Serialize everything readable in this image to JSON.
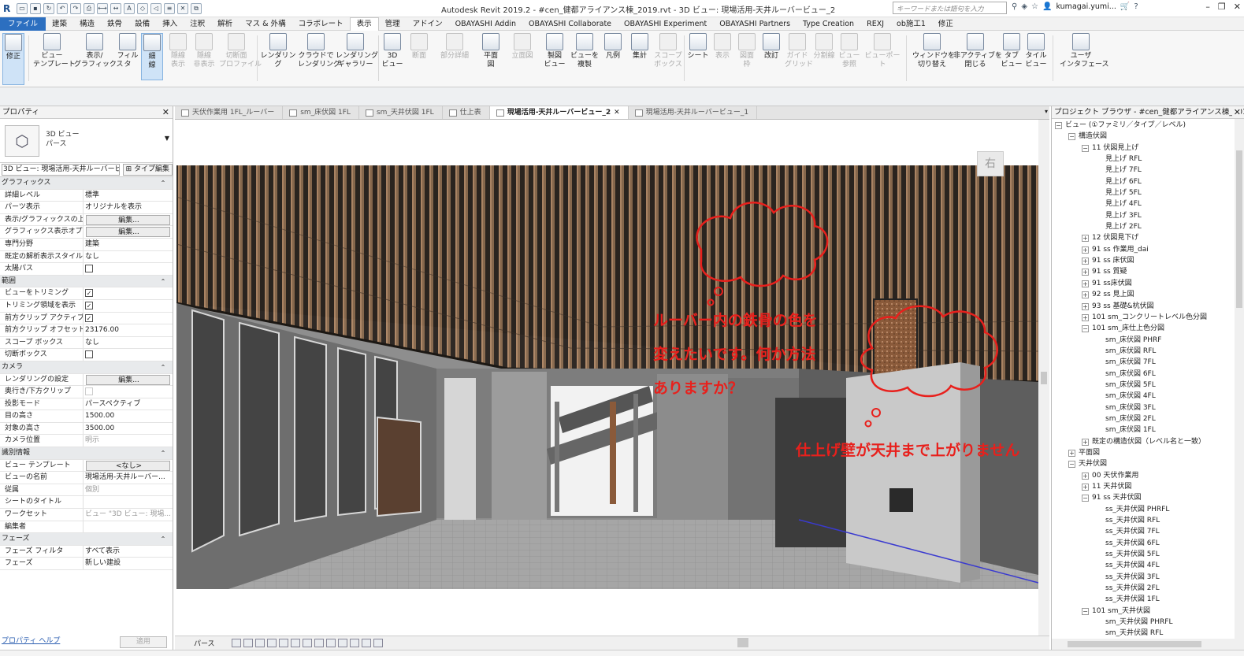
{
  "window": {
    "title": "Autodesk Revit 2019.2 - #cen_健都アライアンス棟_2019.rvt - 3D ビュー: 現場活用-天井ルーバービュー_2",
    "search_placeholder": "キーワードまたは語句を入力",
    "user": "kumagai.yumi...",
    "help": "?"
  },
  "ribbon_tabs": [
    "ファイル",
    "建築",
    "構造",
    "鉄骨",
    "設備",
    "挿入",
    "注釈",
    "解析",
    "マス & 外構",
    "コラボレート",
    "表示",
    "管理",
    "アドイン",
    "OBAYASHI Addin",
    "OBAYASHI Collaborate",
    "OBAYASHI Experiment",
    "OBAYASHI Partners",
    "Type Creation",
    "REXJ",
    "ob施工1",
    "修正"
  ],
  "ribbon_active_tab": "表示",
  "ribbon": {
    "modify": "修正",
    "view_template": "ビュー\nテンプレート",
    "visibility": "表示/\nグラフィックス",
    "filters": "フィルタ",
    "thin_lines": "細\n線",
    "show_hidden": "隠線\n表示",
    "remove_hidden": "隠線\n非表示",
    "cut_profile": "切断面\nプロファイル",
    "render": "レンダリング",
    "cloud_render": "クラウドで\nレンダリング",
    "render_gallery": "レンダリング\nギャラリー",
    "view_3d": "3D\nビュー",
    "section": "断面",
    "callout": "部分詳細",
    "plan": "平面\n図",
    "elevation": "立面図",
    "drafting": "製図\nビュー",
    "duplicate": "ビューを\n複製",
    "legend": "凡例",
    "schedule": "集計",
    "scope_box": "スコープ\nボックス",
    "sheet": "シート",
    "view_ref": "表示",
    "title_block": "図面\n枠",
    "revision": "改訂",
    "guide_grid": "ガイド\nグリッド",
    "matchline": "分割線",
    "view_reference": "ビュー\n参照",
    "viewport": "ビューポート",
    "switch_window": "ウィンドウを\n切り替え",
    "close_inactive": "非アクティブを\n閉じる",
    "tab_views": "タブ\nビュー",
    "tile_views": "タイル\nビュー",
    "user_interface": "ユーザ\nインタフェース"
  },
  "properties": {
    "title": "プロパティ",
    "type_name": "3D ビュー\nパース",
    "view_selector": "3D ビュー: 現場活用-天井ルーバービ",
    "type_edit": "タイプ編集",
    "categories": [
      {
        "name": "グラフィックス",
        "rows": [
          {
            "k": "詳細レベル",
            "v": "標準"
          },
          {
            "k": "パーツ表示",
            "v": "オリジナルを表示"
          },
          {
            "k": "表示/グラフィックスの上...",
            "v": "編集...",
            "btn": true
          },
          {
            "k": "グラフィックス表示オプシ...",
            "v": "編集...",
            "btn": true
          },
          {
            "k": "専門分野",
            "v": "建築"
          },
          {
            "k": "既定の解析表示スタイル",
            "v": "なし"
          },
          {
            "k": "太陽パス",
            "v": "",
            "check": false
          }
        ]
      },
      {
        "name": "範囲",
        "rows": [
          {
            "k": "ビューをトリミング",
            "v": "",
            "check": true
          },
          {
            "k": "トリミング領域を表示",
            "v": "",
            "check": true
          },
          {
            "k": "前方クリップ アクティブ",
            "v": "",
            "check": true
          },
          {
            "k": "前方クリップ オフセット",
            "v": "23176.00"
          },
          {
            "k": "スコープ ボックス",
            "v": "なし"
          },
          {
            "k": "切断ボックス",
            "v": "",
            "check": false
          }
        ]
      },
      {
        "name": "カメラ",
        "rows": [
          {
            "k": "レンダリングの設定",
            "v": "編集...",
            "btn": true
          },
          {
            "k": "奥行き/下方クリップ",
            "v": "",
            "check": false,
            "disabled": true
          },
          {
            "k": "投影モード",
            "v": "パースペクティブ"
          },
          {
            "k": "目の高さ",
            "v": "1500.00"
          },
          {
            "k": "対象の高さ",
            "v": "3500.00"
          },
          {
            "k": "カメラ位置",
            "v": "明示",
            "gray": true
          }
        ]
      },
      {
        "name": "識別情報",
        "rows": [
          {
            "k": "ビュー テンプレート",
            "v": "<なし>",
            "btn": true
          },
          {
            "k": "ビューの名前",
            "v": "現場活用-天井ルーバー..."
          },
          {
            "k": "従属",
            "v": "個別",
            "gray": true
          },
          {
            "k": "シートのタイトル",
            "v": ""
          },
          {
            "k": "ワークセット",
            "v": "ビュー \"3D ビュー: 現場...",
            "gray": true
          },
          {
            "k": "編集者",
            "v": ""
          }
        ]
      },
      {
        "name": "フェーズ",
        "rows": [
          {
            "k": "フェーズ フィルタ",
            "v": "すべて表示"
          },
          {
            "k": "フェーズ",
            "v": "新しい建設"
          }
        ]
      }
    ],
    "help": "プロパティ ヘルプ",
    "apply": "適用"
  },
  "view_tabs": [
    {
      "label": "天伏作業用 1FL_ルーバー",
      "active": false
    },
    {
      "label": "sm_床伏図 1FL",
      "active": false
    },
    {
      "label": "sm_天井伏図 1FL",
      "active": false
    },
    {
      "label": "仕上表",
      "active": false
    },
    {
      "label": "現場活用-天井ルーバービュー_2",
      "active": true
    },
    {
      "label": "現場活用-天井ルーバービュー_1",
      "active": false
    }
  ],
  "viewport": {
    "viewcube_label": "右",
    "annotation1": [
      "ルーバー内の鉄骨の色を",
      "変えたいです。何か方法",
      "ありますか？"
    ],
    "annotation2": "仕上げ壁が天井まで上がりません",
    "scale_label": "パース"
  },
  "browser": {
    "title": "プロジェクト ブラウザ - #cen_健都アライアンス棟_2019.rvt",
    "nodes": [
      {
        "d": 0,
        "t": "-",
        "label": "ビュー (①ファミリ／タイプ／レベル)"
      },
      {
        "d": 1,
        "t": "-",
        "label": "構造伏図"
      },
      {
        "d": 2,
        "t": "-",
        "label": "11 伏図見上げ"
      },
      {
        "d": 3,
        "t": "",
        "label": "見上げ RFL"
      },
      {
        "d": 3,
        "t": "",
        "label": "見上げ 7FL"
      },
      {
        "d": 3,
        "t": "",
        "label": "見上げ 6FL"
      },
      {
        "d": 3,
        "t": "",
        "label": "見上げ 5FL"
      },
      {
        "d": 3,
        "t": "",
        "label": "見上げ 4FL"
      },
      {
        "d": 3,
        "t": "",
        "label": "見上げ 3FL"
      },
      {
        "d": 3,
        "t": "",
        "label": "見上げ 2FL"
      },
      {
        "d": 2,
        "t": "+",
        "label": "12 伏図見下げ"
      },
      {
        "d": 2,
        "t": "+",
        "label": "91 ss 作業用_dai"
      },
      {
        "d": 2,
        "t": "+",
        "label": "91 ss 床伏図"
      },
      {
        "d": 2,
        "t": "+",
        "label": "91 ss 質疑"
      },
      {
        "d": 2,
        "t": "+",
        "label": "91 ss床伏図"
      },
      {
        "d": 2,
        "t": "+",
        "label": "92 ss 見上図"
      },
      {
        "d": 2,
        "t": "+",
        "label": "93 ss 基礎&杭伏図"
      },
      {
        "d": 2,
        "t": "+",
        "label": "101 sm_コンクリートレベル色分図"
      },
      {
        "d": 2,
        "t": "-",
        "label": "101 sm_床仕上色分図"
      },
      {
        "d": 3,
        "t": "",
        "label": "sm_床伏図 PHRF"
      },
      {
        "d": 3,
        "t": "",
        "label": "sm_床伏図 RFL"
      },
      {
        "d": 3,
        "t": "",
        "label": "sm_床伏図 7FL"
      },
      {
        "d": 3,
        "t": "",
        "label": "sm_床伏図 6FL"
      },
      {
        "d": 3,
        "t": "",
        "label": "sm_床伏図 5FL"
      },
      {
        "d": 3,
        "t": "",
        "label": "sm_床伏図 4FL"
      },
      {
        "d": 3,
        "t": "",
        "label": "sm_床伏図 3FL"
      },
      {
        "d": 3,
        "t": "",
        "label": "sm_床伏図 2FL"
      },
      {
        "d": 3,
        "t": "",
        "label": "sm_床伏図 1FL"
      },
      {
        "d": 2,
        "t": "+",
        "label": "既定の構造伏図（レベル名と一致）"
      },
      {
        "d": 1,
        "t": "+",
        "label": "平面図"
      },
      {
        "d": 1,
        "t": "-",
        "label": "天井伏図"
      },
      {
        "d": 2,
        "t": "+",
        "label": "00 天伏作業用"
      },
      {
        "d": 2,
        "t": "+",
        "label": "11 天井伏図"
      },
      {
        "d": 2,
        "t": "-",
        "label": "91 ss 天井伏図"
      },
      {
        "d": 3,
        "t": "",
        "label": "ss_天井伏図 PHRFL"
      },
      {
        "d": 3,
        "t": "",
        "label": "ss_天井伏図 RFL"
      },
      {
        "d": 3,
        "t": "",
        "label": "ss_天井伏図 7FL"
      },
      {
        "d": 3,
        "t": "",
        "label": "ss_天井伏図 6FL"
      },
      {
        "d": 3,
        "t": "",
        "label": "ss_天井伏図 5FL"
      },
      {
        "d": 3,
        "t": "",
        "label": "ss_天井伏図 4FL"
      },
      {
        "d": 3,
        "t": "",
        "label": "ss_天井伏図 3FL"
      },
      {
        "d": 3,
        "t": "",
        "label": "ss_天井伏図 2FL"
      },
      {
        "d": 3,
        "t": "",
        "label": "ss_天井伏図 1FL"
      },
      {
        "d": 2,
        "t": "-",
        "label": "101 sm_天井伏図"
      },
      {
        "d": 3,
        "t": "",
        "label": "sm_天井伏図 PHRFL"
      },
      {
        "d": 3,
        "t": "",
        "label": "sm_天井伏図 RFL"
      }
    ]
  },
  "colors": {
    "accent": "#2c6fc0",
    "annotation": "#e8201c",
    "louver": "#7a5a40"
  }
}
